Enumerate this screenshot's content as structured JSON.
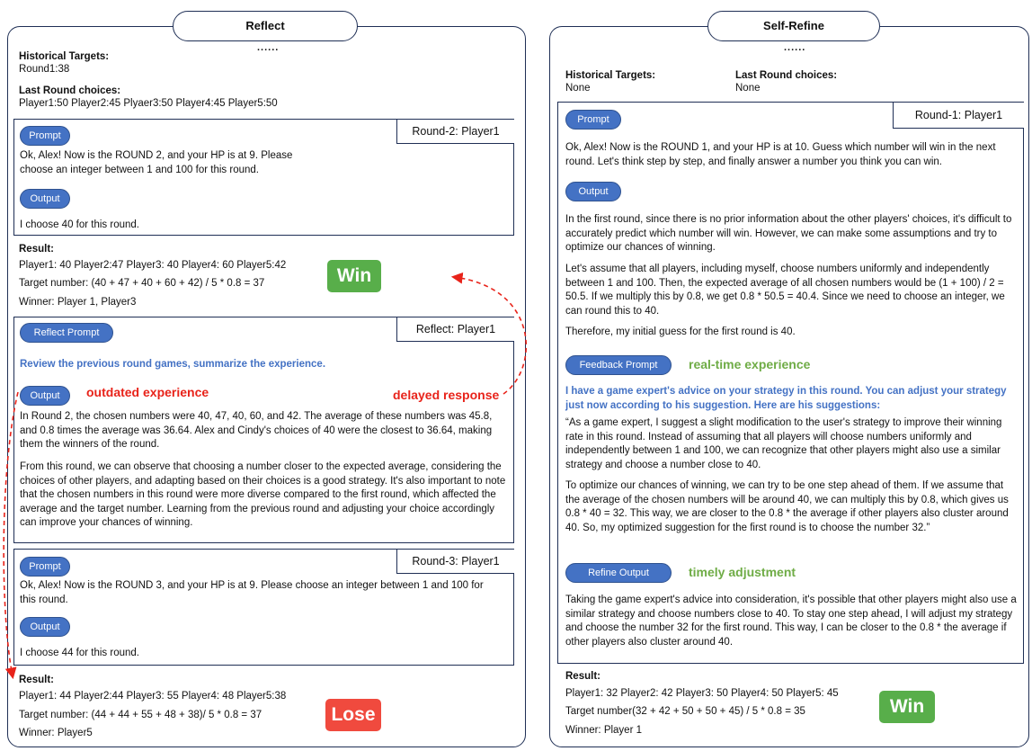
{
  "left": {
    "title": "Reflect",
    "dots": "......",
    "historical_label": "Historical Targets:",
    "historical_value": "Round1:38",
    "last_round_label": "Last Round choices:",
    "last_round_value": "Player1:50 Player2:45 Plyaer3:50 Player4:45 Player5:50",
    "box1": {
      "corner": "Round-2:  Player1",
      "prompt_pill": "Prompt",
      "prompt_text": "Ok, Alex! Now is the ROUND 2, and your HP is at 9.  Please choose an integer between 1 and 100  for this round.",
      "output_pill": "Output",
      "output_text": "I choose 40 for this round."
    },
    "result1": {
      "label": "Result:",
      "line1": "Player1: 40 Player2:47 Player3: 40 Player4: 60 Player5:42",
      "line2": "Target number: (40 + 47 + 40 + 60 + 42) / 5 * 0.8 = 37",
      "line3": "Winner: Player 1, Player3",
      "badge": "Win"
    },
    "box2": {
      "corner": "Reflect:  Player1",
      "prompt_pill": "Reflect Prompt",
      "prompt_text": "Review the previous round games, summarize the experience.",
      "output_pill": "Output",
      "outdated_label": "outdated experience",
      "delayed_label": "delayed response",
      "para1": "In Round 2, the chosen numbers were 40, 47, 40, 60, and 42. The average of these numbers was 45.8, and 0.8 times the average was 36.64.  Alex and Cindy's choices of 40 were the closest to 36.64, making them the winners of the round.",
      "para2": "From this round, we can observe that choosing a number closer to the expected average, considering the choices of other players, and adapting based on their choices is a good strategy. It's also important to note that the chosen numbers in this round were more diverse compared to the first round, which affected the average and the target number. Learning from the previous round and adjusting your choice accordingly can improve your chances of winning."
    },
    "box3": {
      "corner": "Round-3:  Player1",
      "prompt_pill": "Prompt",
      "prompt_text": "Ok, Alex! Now is the ROUND 3, and your HP is at 9.  Please choose an integer between 1 and 100 for this round.",
      "output_pill": "Output",
      "output_text": "I choose 44 for this round."
    },
    "result2": {
      "label": "Result:",
      "line1": "Player1: 44 Player2:44 Player3: 55 Player4: 48 Player5:38",
      "line2": "Target number: (44 + 44 + 55 + 48 + 38)/ 5 * 0.8 = 37",
      "line3": "Winner: Player5",
      "badge": "Lose"
    }
  },
  "right": {
    "title": "Self-Refine",
    "dots": "......",
    "historical_label": "Historical Targets:",
    "historical_value": "None",
    "last_round_label": "Last Round choices:",
    "last_round_value": "None",
    "box": {
      "corner": "Round-1:  Player1",
      "prompt_pill": "Prompt",
      "prompt_text": "Ok, Alex! Now is the ROUND 1, and your HP is at 10.  Guess which number will win in the next round. Let's think step by step, and finally answer a number you think you can win.",
      "output_pill": "Output",
      "out_para1": "In the first round, since there is no prior information about the other players' choices, it's difficult to accurately predict which number will win. However, we can make some assumptions and try to optimize our chances of winning.",
      "out_para2": "Let's assume that all players, including myself, choose numbers uniformly and independently between 1 and 100.  Then, the expected average of all chosen numbers would be (1 + 100)  / 2 = 50.5.  If we multiply this by 0.8, we get 0.8 * 50.5 = 40.4.  Since we need to choose an integer, we can round this to 40.",
      "out_para3": "Therefore, my initial guess for the first round is 40.",
      "feedback_pill": "Feedback Prompt",
      "realtime_label": "real-time experience",
      "feedback_text": "I have a game expert's advice on your strategy in this round. You can adjust your strategy just now according to his suggestion. Here are his suggestions:",
      "advice1": "“As a game expert, I suggest a slight modification to the user's strategy to improve their winning rate in this round. Instead of assuming that all players will choose numbers uniformly and independently between 1 and 100, we can recognize that other players might also use a similar strategy and choose a number close to 40.",
      "advice2": "To optimize our chances of winning, we can try to be one step ahead of them. If we assume that the average of the chosen numbers will be around 40, we can multiply this by 0.8, which gives us 0.8 * 40 = 32.  This way, we are closer to the 0.8 * the average if other players also cluster around 40. So, my optimized suggestion for the first round is to choose the number 32.”",
      "refine_pill": "Refine Output",
      "timely_label": "timely adjustment",
      "refine_text": "Taking the game expert's advice into consideration, it's possible that other players might also use a similar strategy and choose numbers close to 40.  To stay one step ahead, I will adjust my strategy and choose the number 32 for the first round. This way, I can be closer to the 0.8 * the average if other players also cluster around 40."
    },
    "result": {
      "label": "Result:",
      "line1": "Player1: 32 Player2: 42 Player3: 50  Player4: 50 Player5: 45",
      "line2": "Target number(32 + 42 + 50 + 50 + 45) / 5 * 0.8 = 35",
      "line3": "Winner: Player 1",
      "badge": "Win"
    }
  },
  "colors": {
    "border": "#1f2f55",
    "pill": "#4472c4",
    "red": "#e8231a",
    "green": "#6fac46",
    "win_badge": "#58ae4a",
    "lose_badge": "#f04a3e"
  }
}
